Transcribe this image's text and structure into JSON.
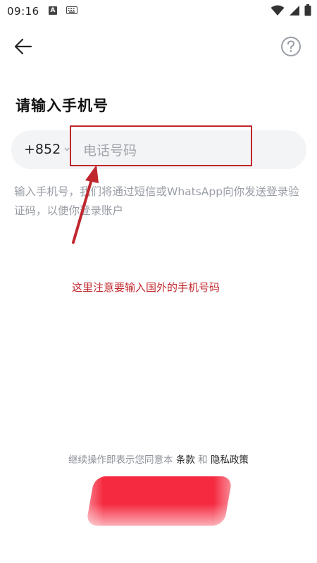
{
  "status_bar": {
    "time": "09:16",
    "a_badge": "A",
    "icons": [
      "a-notification-icon",
      "keyboard-icon",
      "wifi-icon",
      "signal-icon",
      "battery-icon"
    ]
  },
  "header": {
    "back_icon": "arrow-left-icon",
    "help_icon": "question-circle-icon"
  },
  "page": {
    "title": "请输入手机号"
  },
  "phone": {
    "country_code": "+852",
    "placeholder": "电话号码",
    "value": ""
  },
  "hint": "输入手机号，我们将通过短信或WhatsApp向你发送登录验证码，以便你登录账户",
  "annotation": {
    "text": "这里注意要输入国外的手机号码",
    "color": "#c0272d"
  },
  "terms": {
    "prefix": "继续操作即表示您同意本",
    "terms_link": "条款",
    "joiner": "和",
    "privacy_link": "隐私政策"
  },
  "colors": {
    "accent": "#f5293f",
    "annotation": "#c0272d",
    "input_bg": "#f3f4f6",
    "hint": "#9a9ea6"
  }
}
